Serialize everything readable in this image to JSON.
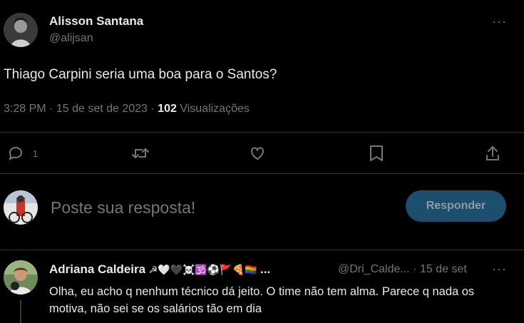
{
  "post": {
    "author_name": "Alisson Santana",
    "author_handle": "@alijsan",
    "text": "Thiago Carpini seria uma boa para o Santos?",
    "time": "3:28 PM",
    "date": "15 de set de 2023",
    "views_count": "102",
    "views_label": "Visualizações",
    "more_icon": "more-dots-icon"
  },
  "actions": {
    "reply_count": "1",
    "icons": [
      "reply-icon",
      "retweet-icon",
      "like-icon",
      "bookmark-icon",
      "share-icon"
    ]
  },
  "composer": {
    "placeholder": "Poste sua resposta!",
    "submit_label": "Responder"
  },
  "reply": {
    "author_name": "Adriana Caldeira",
    "author_emojis": "☭🤍🖤☠️🕉️⚽🚩🍕🏳️‍🌈",
    "ellipsis": "...",
    "author_handle": "@Dri_Calde...",
    "separator": "·",
    "date": "15 de set",
    "text": "Olha, eu acho q nenhum técnico dá jeito. O time não tem alma. Parece q nada os motiva, não sei se os salários tão em dia"
  },
  "colors": {
    "background": "#000000",
    "text_primary": "#e7e9ea",
    "text_secondary": "#71767b",
    "divider": "#2f3336",
    "button_bg": "#1d4e6e"
  }
}
